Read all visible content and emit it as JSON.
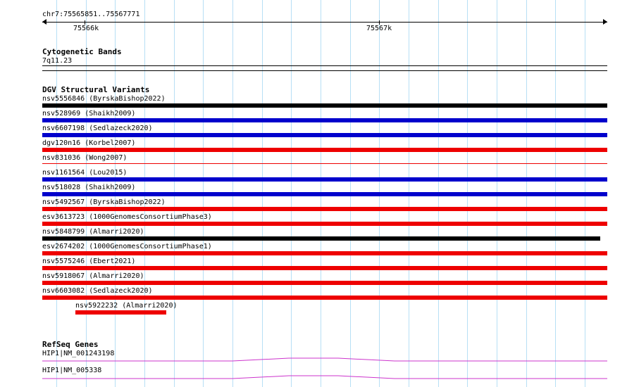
{
  "ruler": {
    "position": "chr7:75565851..75567771",
    "tick_labels": [
      "75566k",
      "75567k"
    ]
  },
  "cytoband": {
    "title": "Cytogenetic Bands",
    "band": "7q11.23"
  },
  "dgv": {
    "title": "DGV Structural Variants",
    "items": [
      {
        "label": "nsv5556846 (ByrskaBishop2022)",
        "color": "#000000"
      },
      {
        "label": "nsv528969 (Shaikh2009)",
        "color": "#0000cc"
      },
      {
        "label": "nsv6607198 (Sedlazeck2020)",
        "color": "#0000cc"
      },
      {
        "label": "dgv120n16 (Korbel2007)",
        "color": "#ee0000"
      },
      {
        "label": "nsv831036 (Wong2007)",
        "color": "#ee0000"
      },
      {
        "label": "nsv1161564 (Lou2015)",
        "color": "#0000cc"
      },
      {
        "label": "nsv518028 (Shaikh2009)",
        "color": "#0000cc"
      },
      {
        "label": "nsv5492567 (ByrskaBishop2022)",
        "color": "#ee0000"
      },
      {
        "label": "esv3613723 (1000GenomesConsortiumPhase3)",
        "color": "#ee0000"
      },
      {
        "label": "nsv5848799 (Almarri2020)",
        "color": "#000000"
      },
      {
        "label": "esv2674202 (1000GenomesConsortiumPhase1)",
        "color": "#ee0000"
      },
      {
        "label": "nsv5575246 (Ebert2021)",
        "color": "#ee0000"
      },
      {
        "label": "nsv5918067 (Almarri2020)",
        "color": "#ee0000"
      },
      {
        "label": "nsv6603082 (Sedlazeck2020)",
        "color": "#ee0000"
      },
      {
        "label": "nsv5922232 (Almarri2020)",
        "color": "#ee0000"
      }
    ]
  },
  "refseq": {
    "title": "RefSeq Genes",
    "items": [
      {
        "label": "HIP1|NM_001243198",
        "color": "#cc33cc"
      },
      {
        "label": "HIP1|NM_005338",
        "color": "#cc33cc"
      }
    ]
  }
}
